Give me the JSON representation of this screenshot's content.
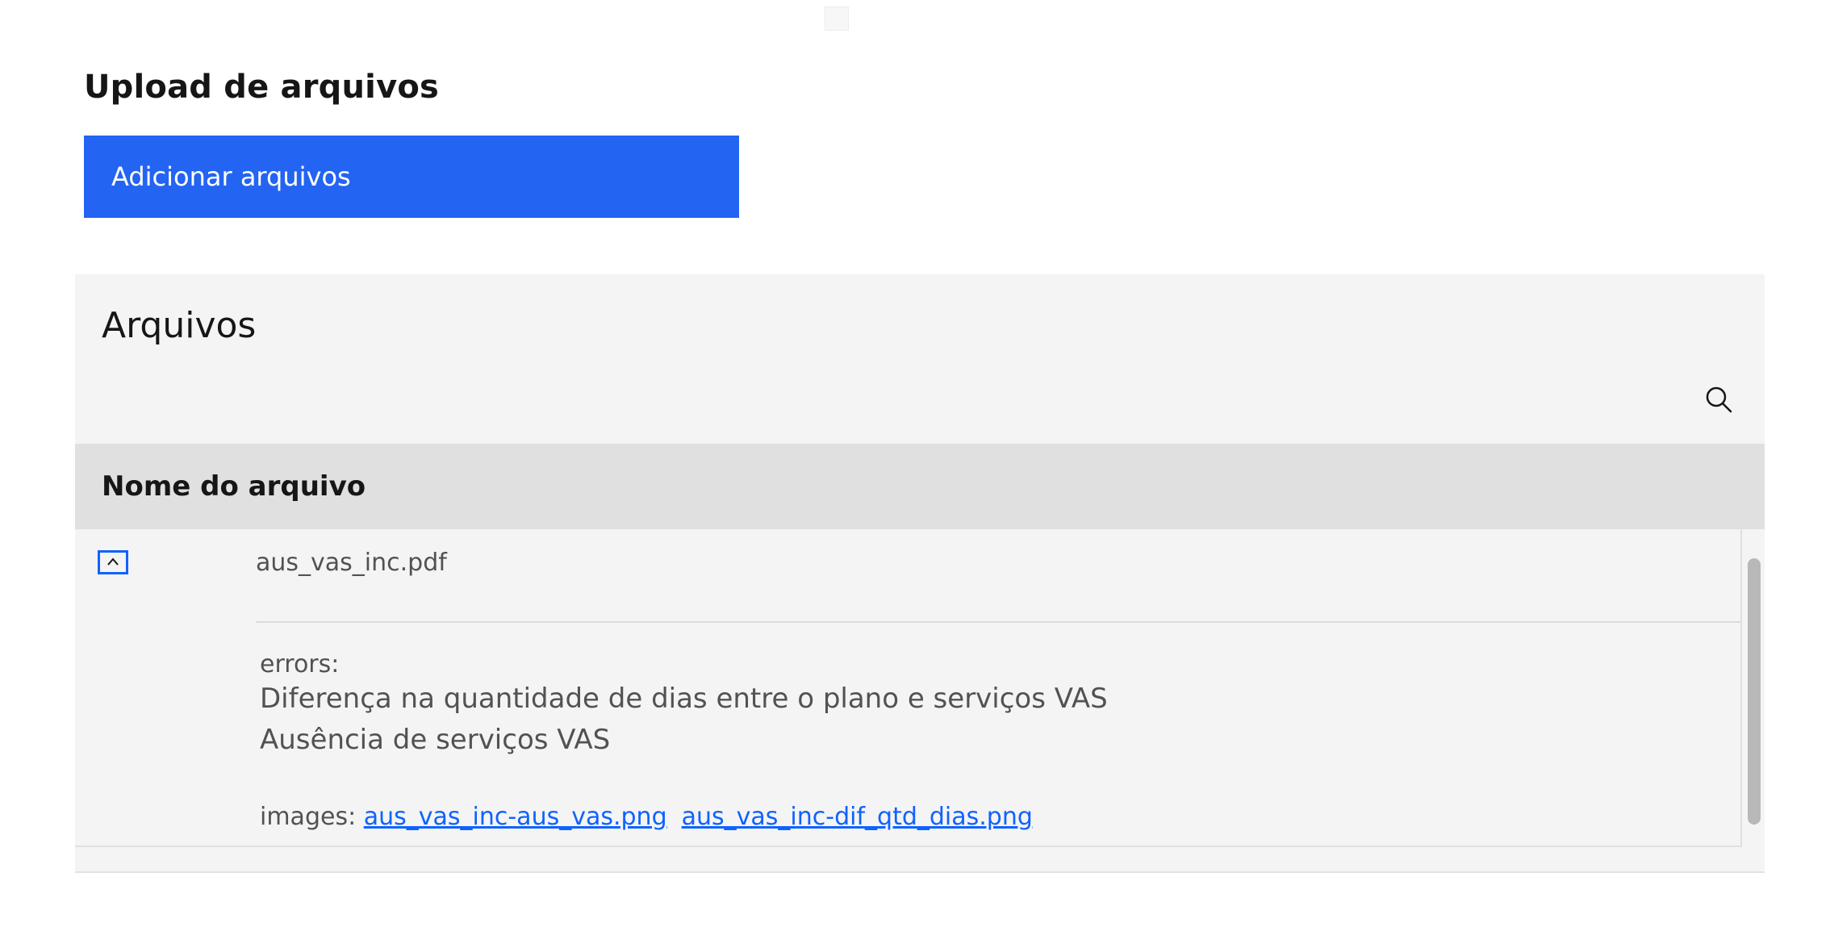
{
  "upload": {
    "title": "Upload de arquivos",
    "button_label": "Adicionar arquivos",
    "button_color": "#2364f2"
  },
  "files": {
    "title": "Arquivos",
    "search_icon": "search-icon",
    "table": {
      "columns": [
        "Nome do arquivo"
      ],
      "rows": [
        {
          "expanded": true,
          "toggle_icon": "chevron-up-icon",
          "file_name": "aus_vas_inc.pdf",
          "errors_label": "errors:",
          "errors": [
            "Diferença na quantidade de dias entre o plano e serviços VAS",
            "Ausência de serviços VAS"
          ],
          "images_label": "images:",
          "images": [
            "aus_vas_inc-aus_vas.png",
            "aus_vas_inc-dif_qtd_dias.png"
          ]
        }
      ]
    }
  },
  "colors": {
    "link": "#0f62fe",
    "panel_bg": "#f4f4f4",
    "header_bg": "#e0e0e0"
  }
}
